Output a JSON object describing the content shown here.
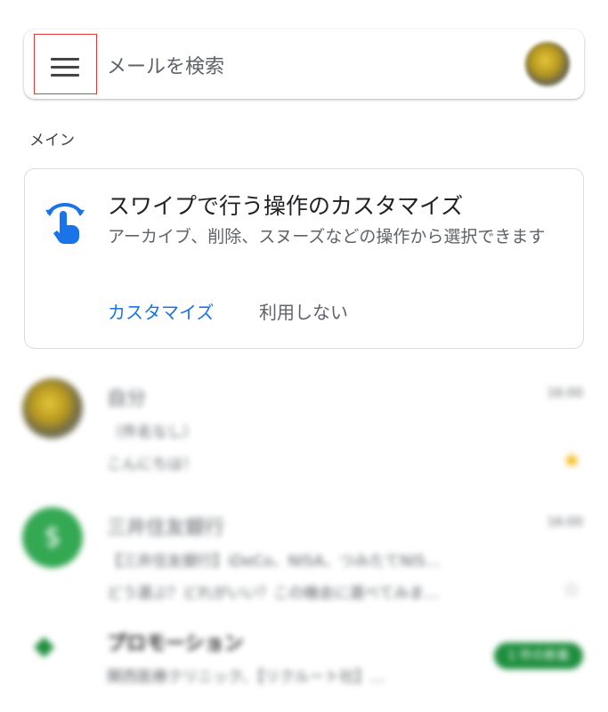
{
  "search": {
    "placeholder": "メールを検索"
  },
  "section": {
    "label": "メイン"
  },
  "tip_card": {
    "title": "スワイプで行う操作のカスタマイズ",
    "description": "アーカイブ、削除、スヌーズなどの操作から選択できます",
    "primary_action": "カスタマイズ",
    "secondary_action": "利用しない",
    "accent_color": "#1a73e8"
  },
  "emails": [
    {
      "sender": "自分",
      "time": "16:00",
      "subject": "（件名なし）",
      "snippet": "こんにちは！",
      "starred": true,
      "avatar": "photo"
    },
    {
      "sender": "三井住友銀行",
      "time": "16:00",
      "subject": "【三井住友銀行】iDeCo、NISA、つみたてNIS…",
      "snippet": "どう選ぶ？どれがいい？この機会に選べてみま…",
      "starred": false,
      "avatar": "$"
    },
    {
      "sender": "プロモーション",
      "snippet": "関西医療クリニック、【リクルート社】…",
      "badge": "1 件の新着",
      "icon": "tag-icon"
    }
  ]
}
